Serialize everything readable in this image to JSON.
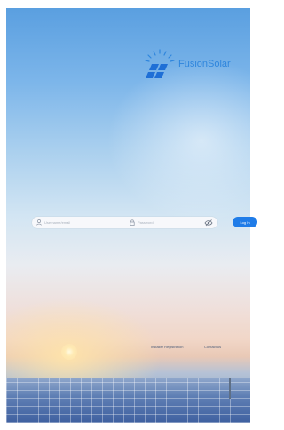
{
  "brand": {
    "name": "FusionSolar",
    "icon": "fusionsolar-logo-icon",
    "color": "#2f86dd"
  },
  "login": {
    "username_placeholder": "Username/email",
    "password_placeholder": "Password",
    "login_label": "Log In",
    "accent": "#1f7ce8"
  },
  "links": {
    "register_label": "Installer Registration",
    "forgot_label": "Contact us"
  },
  "icons": {
    "user": "user-icon",
    "lock": "lock-icon",
    "eye": "eye-icon"
  }
}
